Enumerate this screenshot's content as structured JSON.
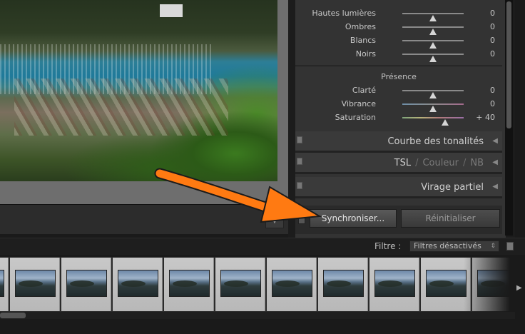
{
  "develop_panel": {
    "tone_sliders": [
      {
        "label": "Hautes lumières",
        "value": "0",
        "position": 0.5
      },
      {
        "label": "Ombres",
        "value": "0",
        "position": 0.5
      },
      {
        "label": "Blancs",
        "value": "0",
        "position": 0.5
      },
      {
        "label": "Noirs",
        "value": "0",
        "position": 0.5
      }
    ],
    "presence": {
      "title": "Présence",
      "sliders": [
        {
          "label": "Clarté",
          "value": "0",
          "position": 0.5
        },
        {
          "label": "Vibrance",
          "value": "0",
          "position": 0.5
        },
        {
          "label": "Saturation",
          "value": "+ 40",
          "position": 0.7
        }
      ]
    },
    "collapsed_sections": {
      "tone_curve": "Courbe des tonalités",
      "hsl": {
        "tsl": "TSL",
        "sep": "/",
        "couleur": "Couleur",
        "nb": "NB"
      },
      "split_toning": "Virage partiel"
    },
    "buttons": {
      "sync": "Synchroniser...",
      "reset": "Réinitialiser"
    }
  },
  "filter_bar": {
    "label": "Filtre :",
    "selected": "Filtres désactivés"
  },
  "filmstrip": {
    "frame_count": 11
  },
  "colors": {
    "annotation_arrow": "#ff7a12",
    "panel_bg": "#333333",
    "app_bg": "#1a1a1a"
  },
  "icons": {
    "section_toggle": "square-switch-icon",
    "collapse": "left-triangle-icon",
    "dropdown": "chevron-down-icon",
    "filmstrip_next": "right-triangle-icon"
  }
}
